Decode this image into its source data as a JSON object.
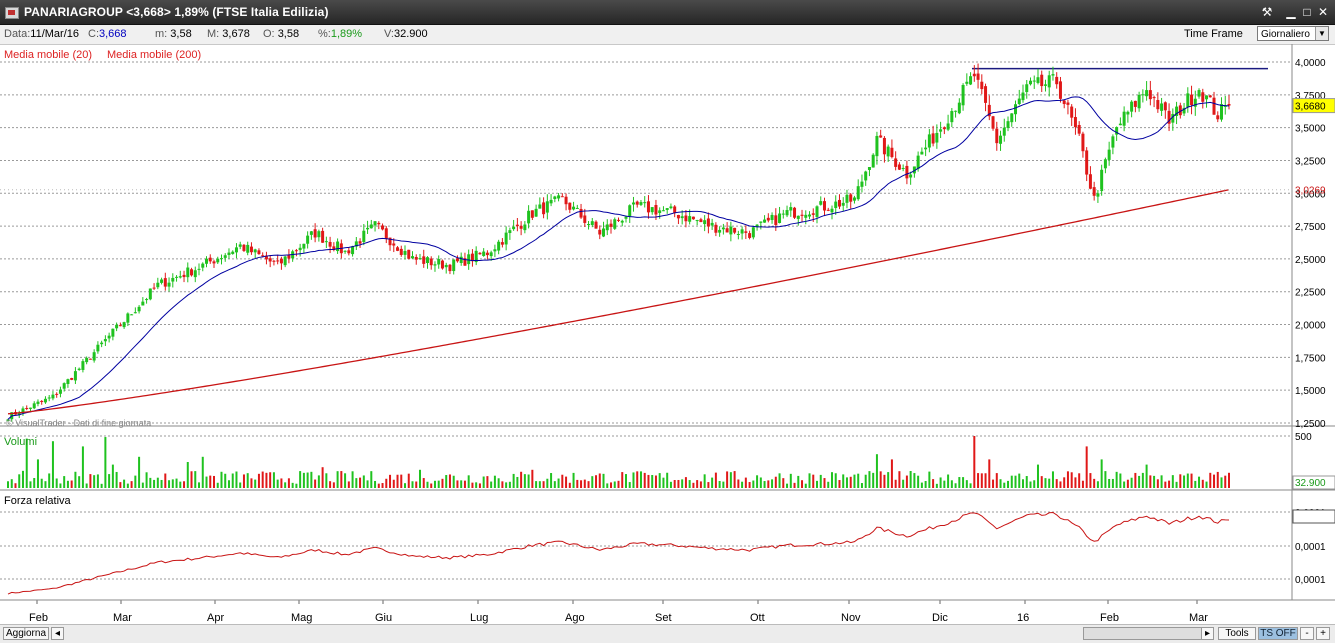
{
  "window": {
    "title": "PANARIAGROUP <3,668> 1,89%  (FTSE Italia Edilizia)",
    "icon": "chart-window-icon",
    "buttons": [
      {
        "name": "tools-icon",
        "glyph": "⚒"
      },
      {
        "name": "minimize-icon",
        "glyph": "▁"
      },
      {
        "name": "maximize-icon",
        "glyph": "□"
      },
      {
        "name": "close-icon",
        "glyph": "✕"
      }
    ]
  },
  "quote": {
    "date_label": "Data:",
    "date": "11/Mar/16",
    "close_label": "C:",
    "close": "3,668",
    "low_label": "m:",
    "low": "3,58",
    "high_label": "M:",
    "high": "3,678",
    "open_label": "O:",
    "open": "3,58",
    "pct_label": "%:",
    "pct": "1,89%",
    "vol_label": "V:",
    "vol": "32.900"
  },
  "timeframe": {
    "label": "Time Frame",
    "value": "Giornaliero"
  },
  "legend": {
    "ma20": "Media mobile (20)",
    "ma200": "Media mobile (200)"
  },
  "watermark": "© VisualTrader - Dati di fine giornata",
  "panels": {
    "volume": "Volumi",
    "rs": "Forza relativa"
  },
  "colors": {
    "up": "#1fc21f",
    "down": "#e01818",
    "ma20": "#0000a0",
    "ma200": "#c81414",
    "resistance": "#1a1a80",
    "grid": "#9a9a9a",
    "rs": "#c81414",
    "last_price_bg": "#ffff00"
  },
  "footer": {
    "update": "Aggiorna",
    "tools": "Tools",
    "ts": "TS OFF",
    "minus": "-",
    "plus": "+"
  },
  "chart_data": [
    {
      "type": "candlestick",
      "title": "PANARIAGROUP",
      "x_labels": [
        "Feb",
        "Mar",
        "Apr",
        "Mag",
        "Giu",
        "Lug",
        "Ago",
        "Set",
        "Ott",
        "Nov",
        "Dic",
        "16",
        "Feb",
        "Mar"
      ],
      "y_ticks": [
        "4,0000",
        "3,7500",
        "3,5000",
        "3,2500",
        "3,0000",
        "2,7500",
        "2,5000",
        "2,2500",
        "2,0000",
        "1,7500",
        "1,5000",
        "1,2500"
      ],
      "ylim": [
        1.25,
        4.0
      ],
      "last_price": "3,6680",
      "ma200_last": "3,0269",
      "resistance": 3.95,
      "anchors": [
        [
          0,
          1.3
        ],
        [
          12,
          1.45
        ],
        [
          25,
          1.85
        ],
        [
          40,
          2.3
        ],
        [
          52,
          2.45
        ],
        [
          62,
          2.6
        ],
        [
          72,
          2.45
        ],
        [
          82,
          2.7
        ],
        [
          90,
          2.55
        ],
        [
          98,
          2.75
        ],
        [
          108,
          2.5
        ],
        [
          118,
          2.45
        ],
        [
          128,
          2.55
        ],
        [
          140,
          2.85
        ],
        [
          148,
          2.95
        ],
        [
          158,
          2.7
        ],
        [
          168,
          2.9
        ],
        [
          178,
          2.85
        ],
        [
          188,
          2.75
        ],
        [
          198,
          2.7
        ],
        [
          208,
          2.85
        ],
        [
          218,
          2.9
        ],
        [
          226,
          2.95
        ],
        [
          232,
          3.4
        ],
        [
          240,
          3.15
        ],
        [
          250,
          3.55
        ],
        [
          258,
          3.9
        ],
        [
          264,
          3.4
        ],
        [
          272,
          3.8
        ],
        [
          280,
          3.85
        ],
        [
          286,
          3.4
        ],
        [
          290,
          2.95
        ],
        [
          296,
          3.5
        ],
        [
          304,
          3.8
        ],
        [
          310,
          3.55
        ],
        [
          318,
          3.8
        ],
        [
          323,
          3.6
        ],
        [
          326,
          3.668
        ]
      ],
      "series": [
        {
          "name": "Media mobile (20)",
          "period": 20
        },
        {
          "name": "Media mobile (200)",
          "period": 200
        }
      ]
    },
    {
      "type": "bar",
      "title": "Volumi",
      "y_ticks": [
        "500"
      ],
      "last_value": "32.900"
    },
    {
      "type": "line",
      "title": "Forza relativa",
      "y_ticks": [
        "0,0001",
        "0,0001",
        "0,0001"
      ]
    }
  ]
}
